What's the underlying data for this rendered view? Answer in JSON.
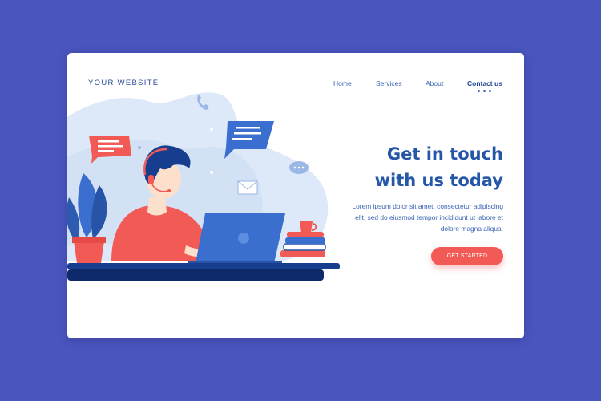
{
  "header": {
    "logo_text": "YOUR WEBSITE",
    "nav": {
      "home": "Home",
      "services": "Services",
      "about": "About",
      "contact": "Contact us"
    }
  },
  "hero": {
    "headline_line1": "Get in touch",
    "headline_line2": "with us today",
    "body_line1": "Lorem ipsum dolor sit amet, consectetur adipiscing",
    "body_line2": "elit, sed do eiusmod tempor incididunt ut labore et",
    "body_line3": "dolore magna aliqua.",
    "cta_label": "GET STARTED"
  },
  "icons": {
    "phone": "phone-icon",
    "chat": "chat-bubble-icon",
    "mail": "mail-icon",
    "typing": "typing-bubble-icon"
  },
  "colors": {
    "page_background": "#4a55bd",
    "card_background": "#ffffff",
    "accent_blue": "#2656a8",
    "accent_red": "#f25a56",
    "blob_light": "#dde8f8",
    "desk_navy": "#0f2a6b"
  }
}
